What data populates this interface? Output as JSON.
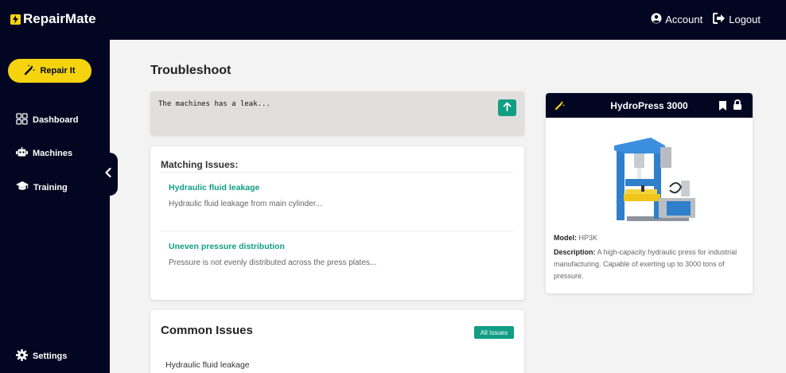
{
  "app": {
    "brand": "RepairMate",
    "account_label": "Account",
    "logout_label": "Logout"
  },
  "sidebar": {
    "repair_label": "Repair It",
    "items": [
      {
        "label": "Dashboard",
        "icon": "grid-icon"
      },
      {
        "label": "Machines",
        "icon": "robot-icon"
      },
      {
        "label": "Training",
        "icon": "graduation-cap-icon"
      }
    ],
    "settings_label": "Settings"
  },
  "main": {
    "title": "Troubleshoot",
    "prompt_value": "The machines has a leak...",
    "matching": {
      "title": "Matching Issues:",
      "issues": [
        {
          "name": "Hydraulic fluid leakage",
          "desc": "Hydraulic fluid leakage from main cylinder..."
        },
        {
          "name": "Uneven pressure distribution",
          "desc": "Pressure is not evenly distributed across the press plates..."
        }
      ]
    },
    "common": {
      "title": "Common Issues",
      "all_label": "All Issues",
      "items": [
        "Hydraulic fluid leakage"
      ]
    }
  },
  "machine": {
    "name": "HydroPress 3000",
    "model_label": "Model:",
    "model": "HP3K",
    "desc_label": "Description:",
    "description": "A high-capacity hydraulic press for industrial manufacturing. Capable of exerting up to 3000 tons of pressure."
  },
  "colors": {
    "navy": "#030621",
    "accent_yellow": "#f5d40f",
    "accent_teal": "#119e84",
    "background": "#f3f3f3"
  }
}
